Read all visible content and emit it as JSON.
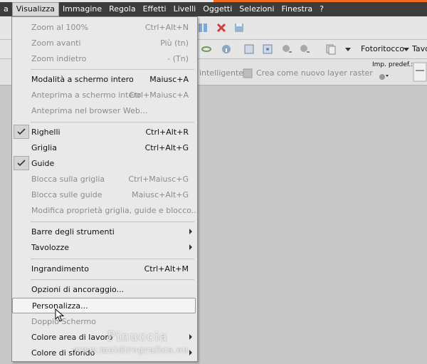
{
  "menubar": {
    "items": [
      "a",
      "Visualizza",
      "Immagine",
      "Regola",
      "Effetti",
      "Livelli",
      "Oggetti",
      "Selezioni",
      "Finestra",
      "?"
    ],
    "active_index": 1
  },
  "toolbar": {
    "workspace_label": "Fotoritocco",
    "tavolozze_label": "Tavo",
    "smart_label": "intelligente",
    "raster_checkbox_label": "Crea come nuovo layer raster",
    "preset_label": "Imp. predef.:"
  },
  "menu": {
    "items": [
      {
        "label": "Zoom al 100%",
        "shortcut": "Ctrl+Alt+N",
        "disabled": true
      },
      {
        "label": "Zoom avanti",
        "shortcut": "Più (tn)",
        "disabled": true
      },
      {
        "label": "Zoom indietro",
        "shortcut": "- (Tn)",
        "disabled": true
      },
      {
        "label": "Modalità a schermo intero",
        "shortcut": "Maiusc+A"
      },
      {
        "label": "Anteprima a schermo intero",
        "shortcut": "Ctrl+Maiusc+A",
        "disabled": true
      },
      {
        "label": "Anteprima nel browser Web...",
        "shortcut": "",
        "disabled": true
      },
      {
        "label": "Righelli",
        "shortcut": "Ctrl+Alt+R",
        "checked": true
      },
      {
        "label": "Griglia",
        "shortcut": "Ctrl+Alt+G"
      },
      {
        "label": "Guide",
        "shortcut": "Ctrl+Alt+G",
        "checked": true
      },
      {
        "label": "Blocca sulla griglia",
        "shortcut": "Ctrl+Maiusc+G",
        "disabled": true
      },
      {
        "label": "Blocca sulle guide",
        "shortcut": "Maiusc+Alt+G",
        "disabled": true
      },
      {
        "label": "Modifica proprietà griglia, guide e blocco...",
        "shortcut": "",
        "disabled": true
      },
      {
        "label": "Barre degli strumenti",
        "shortcut": "",
        "submenu": true
      },
      {
        "label": "Tavolozze",
        "shortcut": "",
        "submenu": true
      },
      {
        "label": "Ingrandimento",
        "shortcut": "Ctrl+Alt+M"
      },
      {
        "label": "Opzioni di ancoraggio...",
        "shortcut": ""
      },
      {
        "label": "Personalizza...",
        "shortcut": "",
        "highlighted": true
      },
      {
        "label": "Doppio Schermo",
        "shortcut": "",
        "disabled": true
      },
      {
        "label": "Colore area di lavoro",
        "shortcut": "",
        "submenu": true
      },
      {
        "label": "Colore di sfondo",
        "shortcut": "",
        "submenu": true
      }
    ]
  },
  "watermark": {
    "name": "Pinuccia",
    "site": "www.maidiregrafica.eu"
  },
  "colors": {
    "menubar_bg": "#3c3c3c",
    "accent_orange": "#f26a1b",
    "menu_bg": "#e9e9e9",
    "workspace_bg": "#c8c8c8"
  }
}
